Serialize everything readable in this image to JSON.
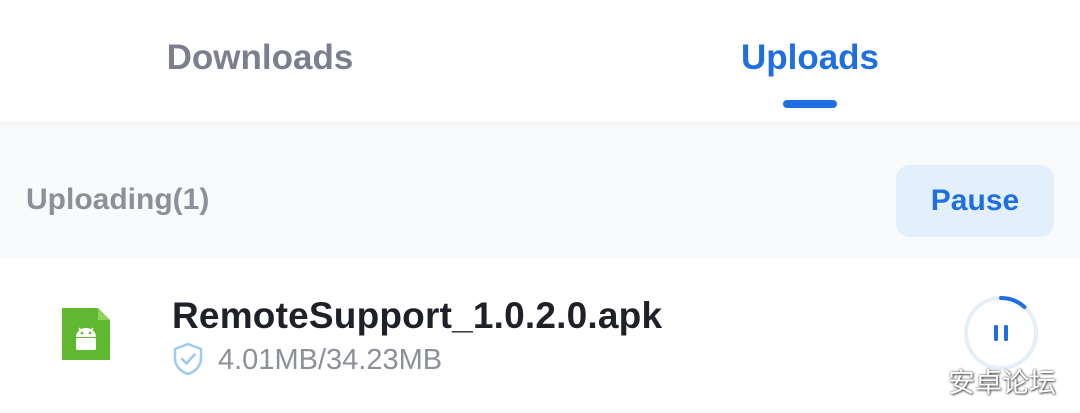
{
  "tabs": [
    {
      "label": "Downloads",
      "active": false
    },
    {
      "label": "Uploads",
      "active": true
    }
  ],
  "section": {
    "title": "Uploading(1)",
    "pause_label": "Pause"
  },
  "items": [
    {
      "file_name": "RemoteSupport_1.0.2.0.apk",
      "size_progress": "4.01MB/34.23MB",
      "file_icon": "android-apk-icon",
      "status_icon": "shield-check-icon",
      "action_icon": "pause-icon",
      "progress": 0.117
    }
  ],
  "watermark": "安卓论坛",
  "colors": {
    "accent": "#1f6fe0",
    "inactive_tab": "#7b7f8e",
    "apk_green": "#5fb830",
    "pause_bg": "#e3f0fb",
    "muted_text": "#8c9098"
  }
}
